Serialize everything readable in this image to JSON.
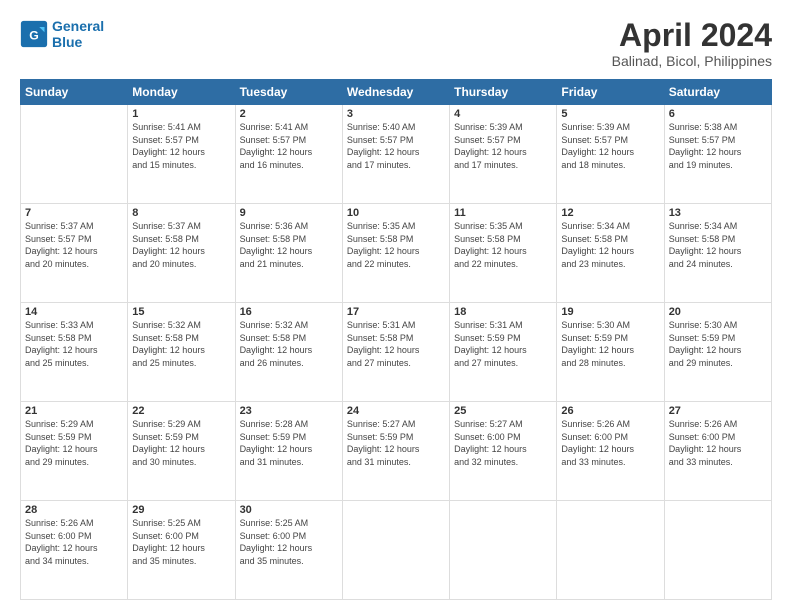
{
  "header": {
    "logo_line1": "General",
    "logo_line2": "Blue",
    "title": "April 2024",
    "subtitle": "Balinad, Bicol, Philippines"
  },
  "calendar": {
    "days_of_week": [
      "Sunday",
      "Monday",
      "Tuesday",
      "Wednesday",
      "Thursday",
      "Friday",
      "Saturday"
    ],
    "weeks": [
      [
        {
          "day": "",
          "info": ""
        },
        {
          "day": "1",
          "info": "Sunrise: 5:41 AM\nSunset: 5:57 PM\nDaylight: 12 hours\nand 15 minutes."
        },
        {
          "day": "2",
          "info": "Sunrise: 5:41 AM\nSunset: 5:57 PM\nDaylight: 12 hours\nand 16 minutes."
        },
        {
          "day": "3",
          "info": "Sunrise: 5:40 AM\nSunset: 5:57 PM\nDaylight: 12 hours\nand 17 minutes."
        },
        {
          "day": "4",
          "info": "Sunrise: 5:39 AM\nSunset: 5:57 PM\nDaylight: 12 hours\nand 17 minutes."
        },
        {
          "day": "5",
          "info": "Sunrise: 5:39 AM\nSunset: 5:57 PM\nDaylight: 12 hours\nand 18 minutes."
        },
        {
          "day": "6",
          "info": "Sunrise: 5:38 AM\nSunset: 5:57 PM\nDaylight: 12 hours\nand 19 minutes."
        }
      ],
      [
        {
          "day": "7",
          "info": "Sunrise: 5:37 AM\nSunset: 5:57 PM\nDaylight: 12 hours\nand 20 minutes."
        },
        {
          "day": "8",
          "info": "Sunrise: 5:37 AM\nSunset: 5:58 PM\nDaylight: 12 hours\nand 20 minutes."
        },
        {
          "day": "9",
          "info": "Sunrise: 5:36 AM\nSunset: 5:58 PM\nDaylight: 12 hours\nand 21 minutes."
        },
        {
          "day": "10",
          "info": "Sunrise: 5:35 AM\nSunset: 5:58 PM\nDaylight: 12 hours\nand 22 minutes."
        },
        {
          "day": "11",
          "info": "Sunrise: 5:35 AM\nSunset: 5:58 PM\nDaylight: 12 hours\nand 22 minutes."
        },
        {
          "day": "12",
          "info": "Sunrise: 5:34 AM\nSunset: 5:58 PM\nDaylight: 12 hours\nand 23 minutes."
        },
        {
          "day": "13",
          "info": "Sunrise: 5:34 AM\nSunset: 5:58 PM\nDaylight: 12 hours\nand 24 minutes."
        }
      ],
      [
        {
          "day": "14",
          "info": "Sunrise: 5:33 AM\nSunset: 5:58 PM\nDaylight: 12 hours\nand 25 minutes."
        },
        {
          "day": "15",
          "info": "Sunrise: 5:32 AM\nSunset: 5:58 PM\nDaylight: 12 hours\nand 25 minutes."
        },
        {
          "day": "16",
          "info": "Sunrise: 5:32 AM\nSunset: 5:58 PM\nDaylight: 12 hours\nand 26 minutes."
        },
        {
          "day": "17",
          "info": "Sunrise: 5:31 AM\nSunset: 5:58 PM\nDaylight: 12 hours\nand 27 minutes."
        },
        {
          "day": "18",
          "info": "Sunrise: 5:31 AM\nSunset: 5:59 PM\nDaylight: 12 hours\nand 27 minutes."
        },
        {
          "day": "19",
          "info": "Sunrise: 5:30 AM\nSunset: 5:59 PM\nDaylight: 12 hours\nand 28 minutes."
        },
        {
          "day": "20",
          "info": "Sunrise: 5:30 AM\nSunset: 5:59 PM\nDaylight: 12 hours\nand 29 minutes."
        }
      ],
      [
        {
          "day": "21",
          "info": "Sunrise: 5:29 AM\nSunset: 5:59 PM\nDaylight: 12 hours\nand 29 minutes."
        },
        {
          "day": "22",
          "info": "Sunrise: 5:29 AM\nSunset: 5:59 PM\nDaylight: 12 hours\nand 30 minutes."
        },
        {
          "day": "23",
          "info": "Sunrise: 5:28 AM\nSunset: 5:59 PM\nDaylight: 12 hours\nand 31 minutes."
        },
        {
          "day": "24",
          "info": "Sunrise: 5:27 AM\nSunset: 5:59 PM\nDaylight: 12 hours\nand 31 minutes."
        },
        {
          "day": "25",
          "info": "Sunrise: 5:27 AM\nSunset: 6:00 PM\nDaylight: 12 hours\nand 32 minutes."
        },
        {
          "day": "26",
          "info": "Sunrise: 5:26 AM\nSunset: 6:00 PM\nDaylight: 12 hours\nand 33 minutes."
        },
        {
          "day": "27",
          "info": "Sunrise: 5:26 AM\nSunset: 6:00 PM\nDaylight: 12 hours\nand 33 minutes."
        }
      ],
      [
        {
          "day": "28",
          "info": "Sunrise: 5:26 AM\nSunset: 6:00 PM\nDaylight: 12 hours\nand 34 minutes."
        },
        {
          "day": "29",
          "info": "Sunrise: 5:25 AM\nSunset: 6:00 PM\nDaylight: 12 hours\nand 35 minutes."
        },
        {
          "day": "30",
          "info": "Sunrise: 5:25 AM\nSunset: 6:00 PM\nDaylight: 12 hours\nand 35 minutes."
        },
        {
          "day": "",
          "info": ""
        },
        {
          "day": "",
          "info": ""
        },
        {
          "day": "",
          "info": ""
        },
        {
          "day": "",
          "info": ""
        }
      ]
    ]
  }
}
